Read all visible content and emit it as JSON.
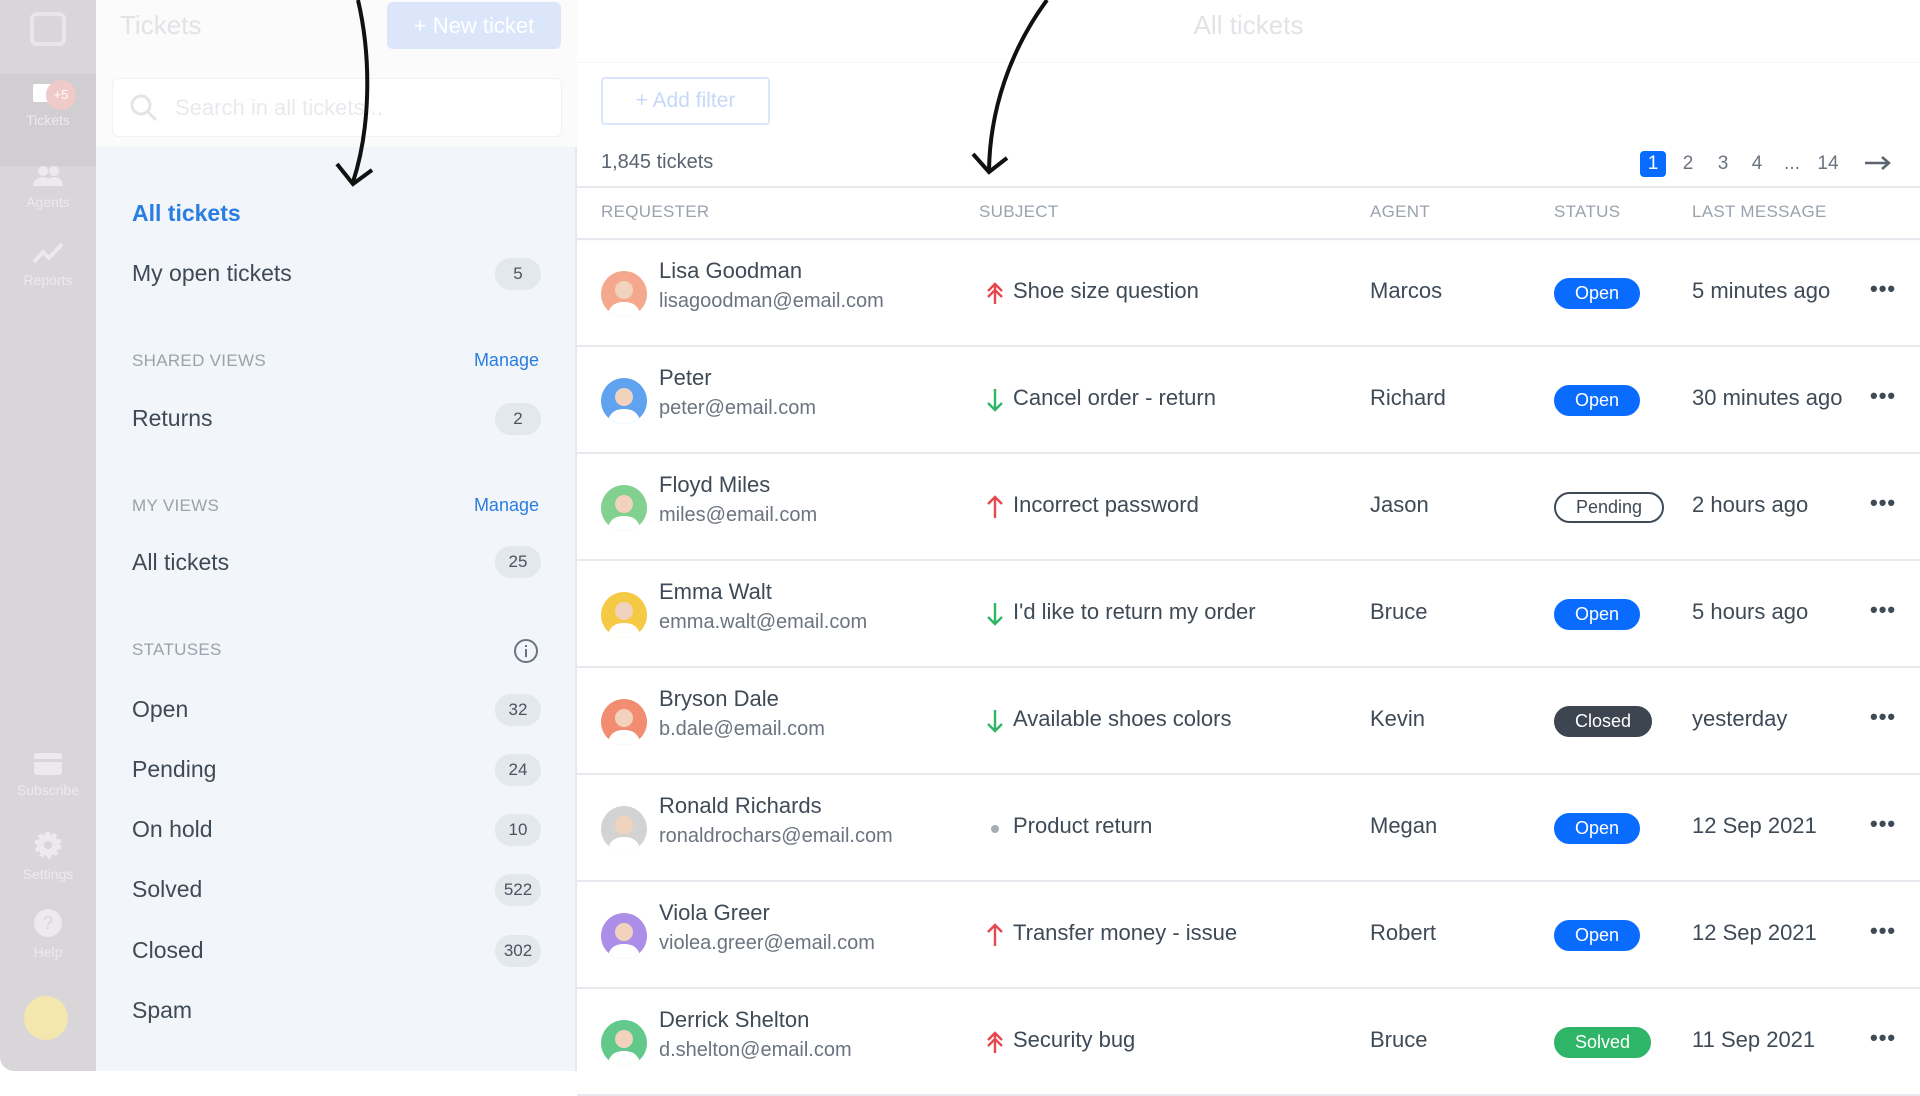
{
  "rail": {
    "items": [
      {
        "label": "Tickets",
        "icon": "ticket-icon",
        "badge": "+5"
      },
      {
        "label": "Agents",
        "icon": "agents-icon"
      },
      {
        "label": "Reports",
        "icon": "reports-icon"
      },
      {
        "label": "Subscribe",
        "icon": "card-icon"
      },
      {
        "label": "Settings",
        "icon": "gear-icon"
      },
      {
        "label": "Help",
        "icon": "help-icon"
      }
    ]
  },
  "sidebar": {
    "title": "Tickets",
    "new_ticket": "+ New ticket",
    "search_placeholder": "Search in all tickets...",
    "all_tickets": "All tickets",
    "my_open": {
      "label": "My open tickets",
      "count": "5"
    },
    "shared_views": {
      "title": "SHARED VIEWS",
      "manage": "Manage",
      "items": [
        {
          "label": "Returns",
          "count": "2"
        }
      ]
    },
    "my_views": {
      "title": "MY VIEWS",
      "manage": "Manage",
      "items": [
        {
          "label": "All tickets",
          "count": "25"
        }
      ]
    },
    "statuses": {
      "title": "STATUSES",
      "items": [
        {
          "label": "Open",
          "count": "32"
        },
        {
          "label": "Pending",
          "count": "24"
        },
        {
          "label": "On hold",
          "count": "10"
        },
        {
          "label": "Solved",
          "count": "522"
        },
        {
          "label": "Closed",
          "count": "302"
        },
        {
          "label": "Spam",
          "count": ""
        }
      ]
    }
  },
  "main": {
    "title": "All tickets",
    "add_filter": "+ Add filter",
    "count": "1,845 tickets",
    "pages": [
      "1",
      "2",
      "3",
      "4",
      "...",
      "14"
    ],
    "current_page": "1",
    "columns": [
      "REQUESTER",
      "SUBJECT",
      "AGENT",
      "STATUS",
      "LAST MESSAGE"
    ],
    "rows": [
      {
        "name": "Lisa Goodman",
        "email": "lisagoodman@email.com",
        "priority": "urgent",
        "subject": "Shoe size question",
        "agent": "Marcos",
        "status": "Open",
        "last": "5 minutes ago",
        "avatar": "#f4a98f"
      },
      {
        "name": "Peter",
        "email": "peter@email.com",
        "priority": "low",
        "subject": "Cancel order - return",
        "agent": "Richard",
        "status": "Open",
        "last": "30 minutes ago",
        "avatar": "#5fa3f0"
      },
      {
        "name": "Floyd Miles",
        "email": "miles@email.com",
        "priority": "high",
        "subject": "Incorrect password",
        "agent": "Jason",
        "status": "Pending",
        "last": "2 hours ago",
        "avatar": "#82d190"
      },
      {
        "name": "Emma Walt",
        "email": "emma.walt@email.com",
        "priority": "low",
        "subject": "I'd like to return my order",
        "agent": "Bruce",
        "status": "Open",
        "last": "5 hours ago",
        "avatar": "#f6c945"
      },
      {
        "name": "Bryson Dale",
        "email": "b.dale@email.com",
        "priority": "low",
        "subject": "Available shoes colors",
        "agent": "Kevin",
        "status": "Closed",
        "last": "yesterday",
        "avatar": "#f28d72"
      },
      {
        "name": "Ronald Richards",
        "email": "ronaldrochars@email.com",
        "priority": "normal",
        "subject": "Product return",
        "agent": "Megan",
        "status": "Open",
        "last": "12 Sep 2021",
        "avatar": "#d3d3d3"
      },
      {
        "name": "Viola Greer",
        "email": "violea.greer@email.com",
        "priority": "high",
        "subject": "Transfer money - issue",
        "agent": "Robert",
        "status": "Open",
        "last": "12 Sep 2021",
        "avatar": "#ab8ee8"
      },
      {
        "name": "Derrick Shelton",
        "email": "d.shelton@email.com",
        "priority": "urgent",
        "subject": "Security bug",
        "agent": "Bruce",
        "status": "Solved",
        "last": "11 Sep 2021",
        "avatar": "#62c98b"
      }
    ]
  },
  "colors": {
    "accent": "#0a6cff",
    "open": "#0a6cff",
    "closed": "#3d4650",
    "solved": "#2fb567",
    "urgent": "#e5484d",
    "low": "#2fb567"
  }
}
